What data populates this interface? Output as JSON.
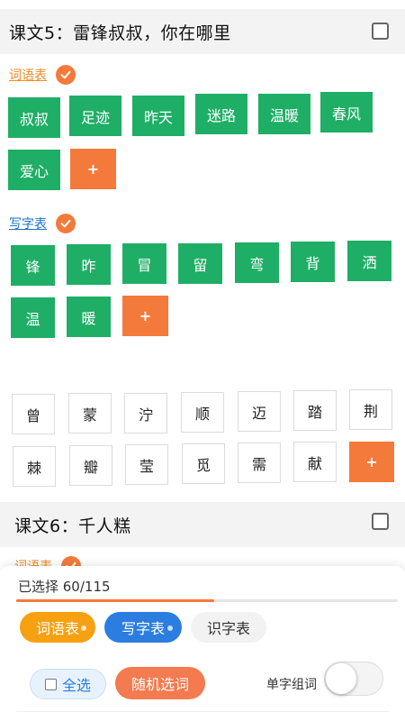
{
  "lesson5": {
    "title": "课文5：雷锋叔叔，你在哪里",
    "vocab_label": "词语表",
    "vocab_words": [
      "叔叔",
      "足迹",
      "昨天",
      "迷路",
      "温暖",
      "春风",
      "爱心"
    ],
    "writing_label": "写字表",
    "writing_chars": [
      "锋",
      "昨",
      "冒",
      "留",
      "弯",
      "背",
      "洒",
      "温",
      "暖"
    ],
    "recognize_chars": [
      "曾",
      "蒙",
      "泞",
      "顺",
      "迈",
      "踏",
      "荆",
      "棘",
      "瓣",
      "莹",
      "觅",
      "需",
      "献"
    ],
    "add_label": "+"
  },
  "lesson6": {
    "title": "课文6：千人糕",
    "vocab_label": "词语表"
  },
  "bottom": {
    "selected_text": "已选择 60/115",
    "progress": 0.52,
    "tab_vocab": "词语表",
    "tab_writing": "写字表",
    "tab_recognize": "识字表",
    "select_all": "全选",
    "random_pick": "随机选词",
    "single_char_label": "单字组词"
  },
  "colors": {
    "green_chip": "#1fae66",
    "orange_accent": "#f47a3c",
    "blue_accent": "#2b7de0",
    "vocab_label": "#f08a24"
  }
}
